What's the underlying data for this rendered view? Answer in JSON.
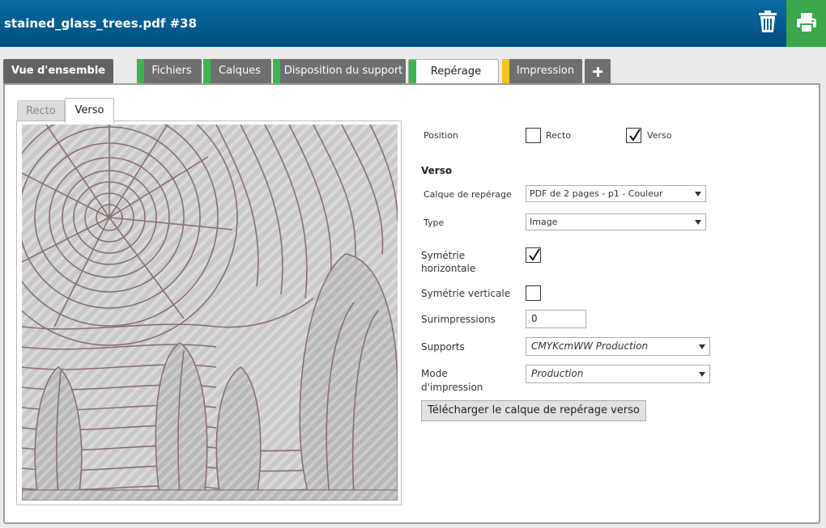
{
  "header": {
    "title": "stained_glass_trees.pdf #38"
  },
  "colors": {
    "header_blue": "#005a8f",
    "print_green": "#3ba64c",
    "status_green": "#3cb550",
    "status_yellow": "#f5c518"
  },
  "tabs": [
    {
      "label": "Vue d'ensemble"
    },
    {
      "label": "Fichiers",
      "status": "green"
    },
    {
      "label": "Calques",
      "status": "green"
    },
    {
      "label": "Disposition du support",
      "status": "green"
    },
    {
      "label": "Repérage",
      "status": "green",
      "active": true
    },
    {
      "label": "Impression",
      "status": "yellow"
    }
  ],
  "subtabs": {
    "recto": "Recto",
    "verso": "Verso"
  },
  "form": {
    "position_label": "Position",
    "recto_label": "Recto",
    "verso_label": "Verso",
    "recto_checked": false,
    "verso_checked": true,
    "section_title": "Verso",
    "calque_label": "Calque de repérage",
    "calque_value": "PDF de 2 pages - p1 - Couleur",
    "type_label": "Type",
    "type_value": "Image",
    "sym_h_label_1": "Symétrie",
    "sym_h_label_2": "horizontale",
    "sym_h_checked": true,
    "sym_v_label": "Symétrie verticale",
    "sym_v_checked": false,
    "surimpressions_label": "Surimpressions",
    "surimpressions_value": "0",
    "supports_label": "Supports",
    "supports_value": "CMYKcmWW Production",
    "mode_label_1": "Mode",
    "mode_label_2": "d'impression",
    "mode_value": "Production",
    "download_button": "Télécharger le calque de repérage verso"
  }
}
